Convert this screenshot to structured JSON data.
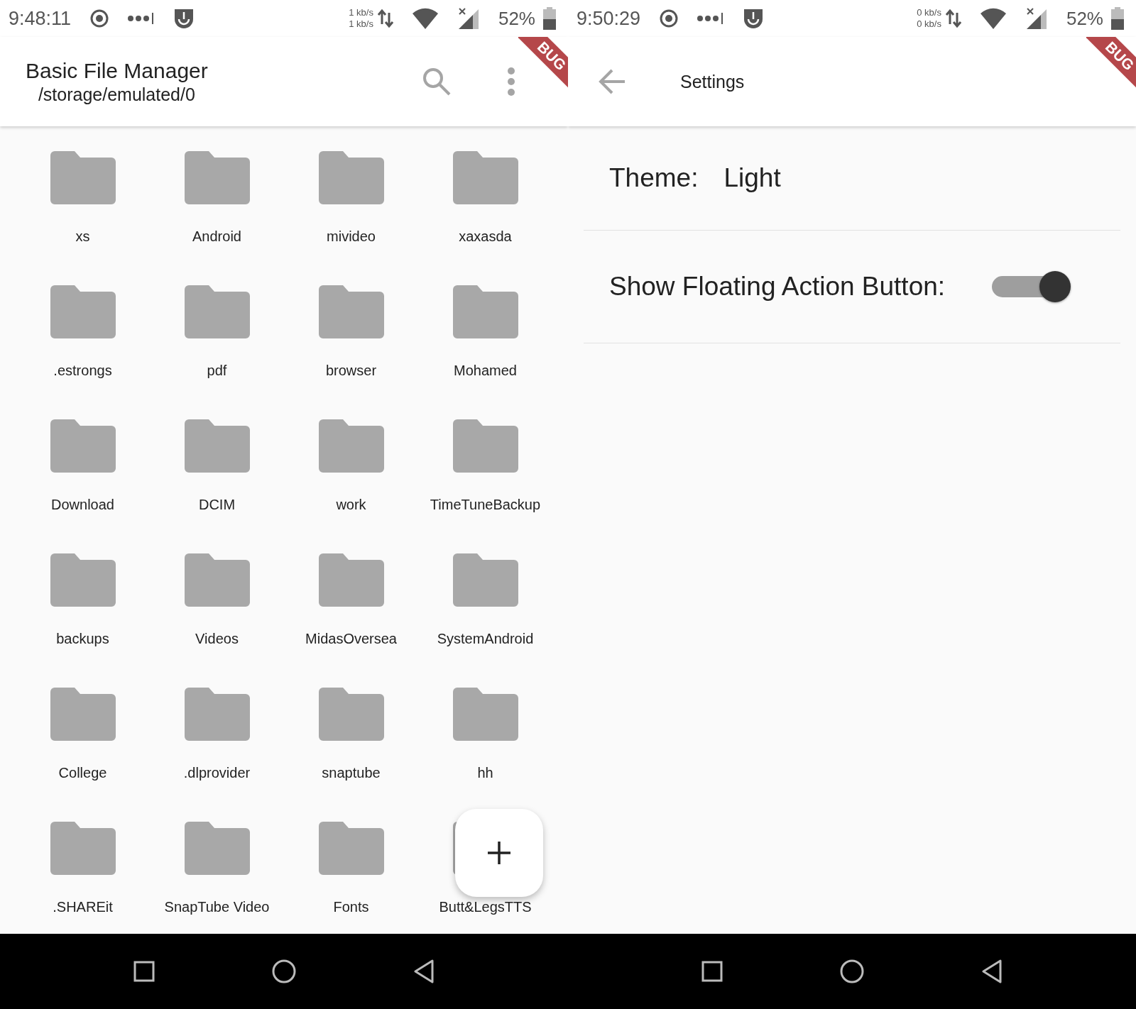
{
  "file_manager": {
    "status_bar": {
      "time": "9:48:11",
      "net_up": "1 kb/s",
      "net_down": "1 kb/s",
      "battery": "52%"
    },
    "app_bar": {
      "title": "Basic File Manager",
      "subtitle": "/storage/emulated/0"
    },
    "debug_banner": "BUG",
    "folders": [
      {
        "name": "xs"
      },
      {
        "name": "Android"
      },
      {
        "name": "mivideo"
      },
      {
        "name": "xaxasda"
      },
      {
        "name": ".estrongs"
      },
      {
        "name": "pdf"
      },
      {
        "name": "browser"
      },
      {
        "name": "Mohamed"
      },
      {
        "name": "Download"
      },
      {
        "name": "DCIM"
      },
      {
        "name": "work"
      },
      {
        "name": "TimeTuneBackup"
      },
      {
        "name": "backups"
      },
      {
        "name": "Videos"
      },
      {
        "name": "MidasOversea"
      },
      {
        "name": "SystemAndroid"
      },
      {
        "name": "College"
      },
      {
        "name": ".dlprovider"
      },
      {
        "name": "snaptube"
      },
      {
        "name": "hh"
      },
      {
        "name": ".SHAREit"
      },
      {
        "name": "SnapTube Video"
      },
      {
        "name": "Fonts"
      },
      {
        "name": "Butt&LegsTTS"
      }
    ],
    "fab": {
      "visible": true
    }
  },
  "settings_screen": {
    "status_bar": {
      "time": "9:50:29",
      "net_up": "0 kb/s",
      "net_down": "0 kb/s",
      "battery": "52%"
    },
    "app_bar": {
      "title": "Settings"
    },
    "debug_banner": "BUG",
    "settings": [
      {
        "kind": "value",
        "label": "Theme:",
        "value": "Light"
      },
      {
        "kind": "switch",
        "label": "Show Floating Action Button:",
        "on": true
      }
    ]
  }
}
